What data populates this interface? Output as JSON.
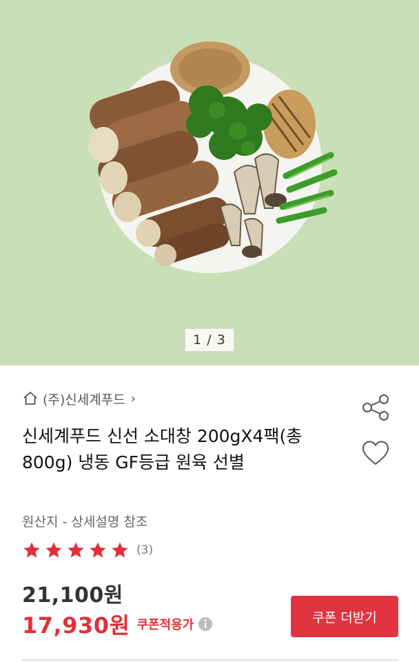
{
  "gallery": {
    "pager_text": "1 / 3",
    "background_color": "#c9dfb7"
  },
  "store": {
    "name": "(주)신세계푸드",
    "home_icon": "home-icon",
    "chevron": "›"
  },
  "product": {
    "title": "신세계푸드 신선 소대창 200gX4팩(총800g) 냉동 GF등급 원육 선별",
    "origin": "원산지 - 상세설명 참조",
    "rating": {
      "stars": 5,
      "count_text": "(3)"
    },
    "original_price": "21,100원",
    "sale_price": "17,930원",
    "coupon_label": "쿠폰적용가"
  },
  "actions": {
    "share_icon": "share-icon",
    "wishlist_icon": "heart-icon",
    "coupon_button_label": "쿠폰 더받기"
  },
  "colors": {
    "accent_red": "#e0303a",
    "button_red": "#e0343e",
    "star_red": "#e0303a"
  }
}
